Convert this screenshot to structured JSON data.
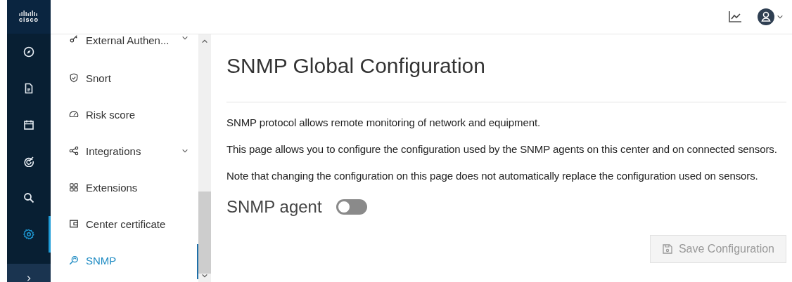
{
  "rail": {
    "logo": "cisco",
    "items": [
      {
        "kind": "compass",
        "selected": false
      },
      {
        "kind": "document",
        "selected": false
      },
      {
        "kind": "calendar",
        "selected": false
      },
      {
        "kind": "target",
        "selected": false
      },
      {
        "kind": "search",
        "selected": false
      },
      {
        "kind": "gear",
        "selected": true
      }
    ]
  },
  "sidebar": {
    "items": [
      {
        "kind": "key",
        "label": "External Authen...",
        "expandable": true,
        "selected": false
      },
      {
        "kind": "shield",
        "label": "Snort",
        "expandable": false,
        "selected": false
      },
      {
        "kind": "gauge",
        "label": "Risk score",
        "expandable": false,
        "selected": false
      },
      {
        "kind": "share",
        "label": "Integrations",
        "expandable": true,
        "selected": false
      },
      {
        "kind": "grid",
        "label": "Extensions",
        "expandable": false,
        "selected": false
      },
      {
        "kind": "certificate",
        "label": "Center certificate",
        "expandable": false,
        "selected": false
      },
      {
        "kind": "snmp",
        "label": "SNMP",
        "expandable": false,
        "selected": true
      }
    ]
  },
  "main": {
    "title": "SNMP Global Configuration",
    "paragraphs": [
      "SNMP protocol allows remote monitoring of network and equipment.",
      "This page allows you to configure the configuration used by the SNMP agents on this center and on connected sensors.",
      "Note that changing the configuration on this page does not automatically replace the configuration used on sensors."
    ],
    "toggle": {
      "label": "SNMP agent",
      "on": false
    },
    "save_button": {
      "label": "Save Configuration",
      "disabled": true
    }
  }
}
